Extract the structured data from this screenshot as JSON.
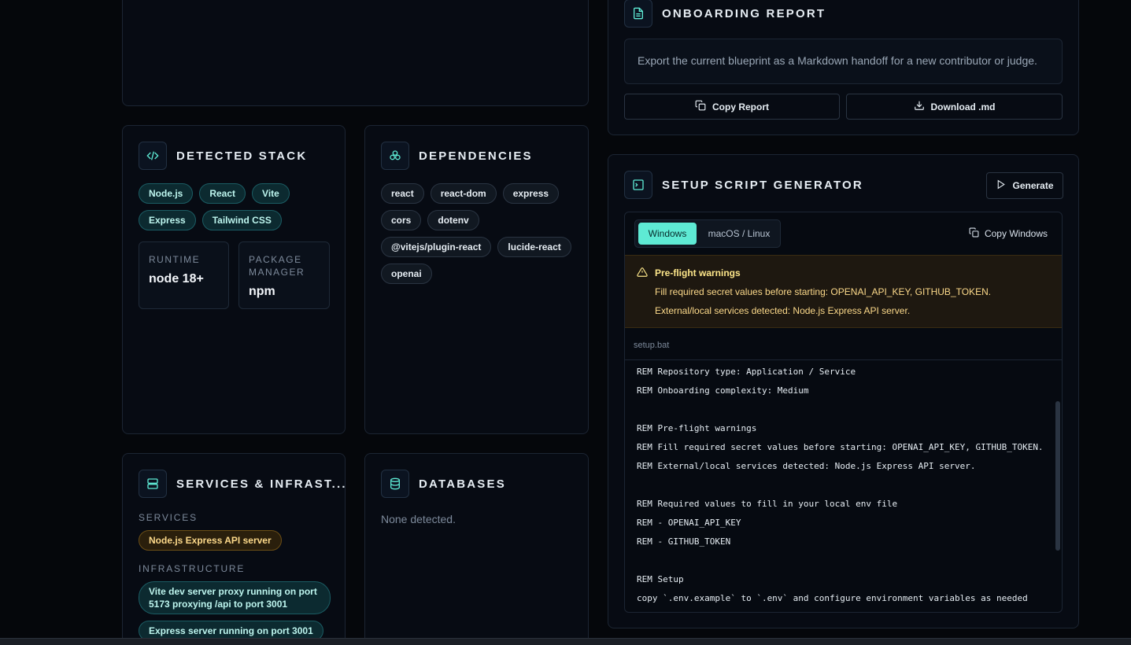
{
  "report": {
    "title": "ONBOARDING REPORT",
    "description": "Export the current blueprint as a Markdown handoff for a new contributor or judge.",
    "copy_label": "Copy Report",
    "download_label": "Download .md"
  },
  "stack": {
    "title": "DETECTED STACK",
    "chips": [
      "Node.js",
      "React",
      "Vite",
      "Express",
      "Tailwind CSS"
    ],
    "runtime_label": "RUNTIME",
    "runtime_value": "node 18+",
    "pm_label": "PACKAGE MANAGER",
    "pm_value": "npm"
  },
  "deps": {
    "title": "DEPENDENCIES",
    "chips": [
      "react",
      "react-dom",
      "express",
      "cors",
      "dotenv",
      "@vitejs/plugin-react",
      "lucide-react",
      "openai"
    ]
  },
  "services": {
    "title": "SERVICES & INFRAST...",
    "services_label": "SERVICES",
    "services": [
      "Node.js Express API server"
    ],
    "infra_label": "INFRASTRUCTURE",
    "infra": [
      "Vite dev server proxy running on port 5173 proxying /api to port 3001",
      "Express server running on port 3001"
    ]
  },
  "databases": {
    "title": "DATABASES",
    "empty": "None detected."
  },
  "setup": {
    "title": "SETUP SCRIPT GENERATOR",
    "generate_label": "Generate",
    "tabs": [
      "Windows",
      "macOS / Linux"
    ],
    "copy_label": "Copy Windows",
    "warnings_title": "Pre-flight warnings",
    "warnings": [
      "Fill required secret values before starting: OPENAI_API_KEY, GITHUB_TOKEN.",
      "External/local services detected: Node.js Express API server."
    ],
    "filename": "setup.bat",
    "script_lines": [
      "REM Repository type: Application / Service",
      "REM Onboarding complexity: Medium",
      "",
      "REM Pre-flight warnings",
      "REM Fill required secret values before starting: OPENAI_API_KEY, GITHUB_TOKEN.",
      "REM External/local services detected: Node.js Express API server.",
      "",
      "REM Required values to fill in your local env file",
      "REM - OPENAI_API_KEY",
      "REM - GITHUB_TOKEN",
      "",
      "REM Setup",
      "copy `.env.example` to `.env` and configure environment variables as needed"
    ]
  },
  "colors": {
    "accent": "#5eead4",
    "active_tab": "#5eead4",
    "warning": "#fbbf24"
  }
}
